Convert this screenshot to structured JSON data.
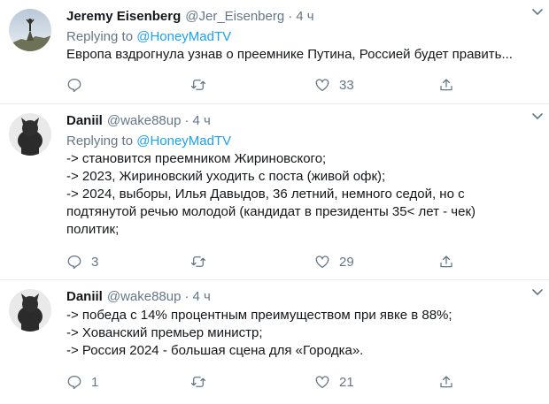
{
  "tweets": [
    {
      "name": "Jeremy Eisenberg",
      "handle": "@Jer_Eisenberg",
      "separator": "·",
      "time": "4 ч",
      "reply_prefix": "Replying to",
      "reply_to": "@HoneyMadTV",
      "lines": [
        "Европа вздрогнула узнав о преемнике Путина, Россией будет править..."
      ],
      "replies": "",
      "retweets": "",
      "likes": "33"
    },
    {
      "name": "Daniil",
      "handle": "@wake88up",
      "separator": "·",
      "time": "4 ч",
      "reply_prefix": "Replying to",
      "reply_to": "@HoneyMadTV",
      "lines": [
        "-> становится преемником Жириновского;",
        "-> 2023, Жириновский уходить с поста (живой офк);",
        "-> 2024, выборы, Илья Давыдов, 36 летний, немного седой, но с",
        "подтянутой речью молодой (кандидат в президенты 35< лет - чек)",
        "политик;"
      ],
      "replies": "3",
      "retweets": "",
      "likes": "29"
    },
    {
      "name": "Daniil",
      "handle": "@wake88up",
      "separator": "·",
      "time": "4 ч",
      "reply_prefix": "",
      "reply_to": "",
      "lines": [
        "-> победа с 14% процентным преимуществом при явке в 88%;",
        "-> Хованский премьер министр;",
        "-> Россия 2024 - большая сцена для «Городка»."
      ],
      "replies": "1",
      "retweets": "",
      "likes": "21"
    }
  ],
  "icons": {
    "reply": "reply-icon",
    "retweet": "retweet-icon",
    "like": "heart-icon",
    "share": "share-icon",
    "caret": "chevron-down-icon"
  },
  "colors": {
    "link": "#1da1f2",
    "secondary_text": "#657786",
    "divider": "#e6ecf0"
  }
}
